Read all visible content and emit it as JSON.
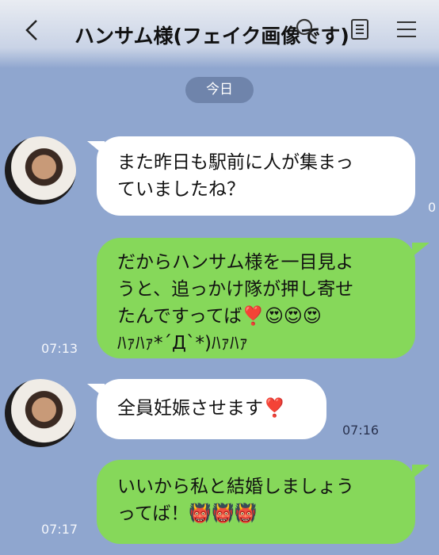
{
  "header": {
    "title": "ハンサム様(フェイク画像です)",
    "back_icon": "chevron-left-icon",
    "search_icon": "search-icon",
    "notes_icon": "notes-icon",
    "menu_icon": "hamburger-menu-icon"
  },
  "date_separator": "今日",
  "messages": [
    {
      "side": "received",
      "text": "また昨日も駅前に人が集まっ\nていましたね？",
      "time": "0"
    },
    {
      "side": "sent",
      "text": "だからハンサム様を一目見よ\nうと、追っかけ隊が押し寄せ\nたんですってば❣️😍😍😍\nﾊｧﾊｧ*´Д`*)ﾊｧﾊｧ",
      "time": "07:13"
    },
    {
      "side": "received",
      "text": "全員妊娠させます❣️",
      "time": "07:16"
    },
    {
      "side": "sent",
      "text": "いいから私と結婚しましょう\nってば！👹👹👹",
      "time": "07:17"
    }
  ],
  "colors": {
    "background": "#8fa6cf",
    "sent_bubble": "#86d85a",
    "received_bubble": "#ffffff"
  }
}
